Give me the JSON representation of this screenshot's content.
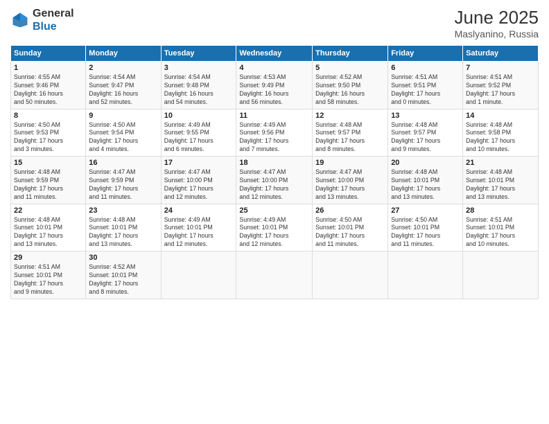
{
  "header": {
    "logo_general": "General",
    "logo_blue": "Blue",
    "title": "June 2025",
    "location": "Maslyanino, Russia"
  },
  "columns": [
    "Sunday",
    "Monday",
    "Tuesday",
    "Wednesday",
    "Thursday",
    "Friday",
    "Saturday"
  ],
  "weeks": [
    [
      {
        "day": "1",
        "info": "Sunrise: 4:55 AM\nSunset: 9:46 PM\nDaylight: 16 hours\nand 50 minutes."
      },
      {
        "day": "2",
        "info": "Sunrise: 4:54 AM\nSunset: 9:47 PM\nDaylight: 16 hours\nand 52 minutes."
      },
      {
        "day": "3",
        "info": "Sunrise: 4:54 AM\nSunset: 9:48 PM\nDaylight: 16 hours\nand 54 minutes."
      },
      {
        "day": "4",
        "info": "Sunrise: 4:53 AM\nSunset: 9:49 PM\nDaylight: 16 hours\nand 56 minutes."
      },
      {
        "day": "5",
        "info": "Sunrise: 4:52 AM\nSunset: 9:50 PM\nDaylight: 16 hours\nand 58 minutes."
      },
      {
        "day": "6",
        "info": "Sunrise: 4:51 AM\nSunset: 9:51 PM\nDaylight: 17 hours\nand 0 minutes."
      },
      {
        "day": "7",
        "info": "Sunrise: 4:51 AM\nSunset: 9:52 PM\nDaylight: 17 hours\nand 1 minute."
      }
    ],
    [
      {
        "day": "8",
        "info": "Sunrise: 4:50 AM\nSunset: 9:53 PM\nDaylight: 17 hours\nand 3 minutes."
      },
      {
        "day": "9",
        "info": "Sunrise: 4:50 AM\nSunset: 9:54 PM\nDaylight: 17 hours\nand 4 minutes."
      },
      {
        "day": "10",
        "info": "Sunrise: 4:49 AM\nSunset: 9:55 PM\nDaylight: 17 hours\nand 6 minutes."
      },
      {
        "day": "11",
        "info": "Sunrise: 4:49 AM\nSunset: 9:56 PM\nDaylight: 17 hours\nand 7 minutes."
      },
      {
        "day": "12",
        "info": "Sunrise: 4:48 AM\nSunset: 9:57 PM\nDaylight: 17 hours\nand 8 minutes."
      },
      {
        "day": "13",
        "info": "Sunrise: 4:48 AM\nSunset: 9:57 PM\nDaylight: 17 hours\nand 9 minutes."
      },
      {
        "day": "14",
        "info": "Sunrise: 4:48 AM\nSunset: 9:58 PM\nDaylight: 17 hours\nand 10 minutes."
      }
    ],
    [
      {
        "day": "15",
        "info": "Sunrise: 4:48 AM\nSunset: 9:59 PM\nDaylight: 17 hours\nand 11 minutes."
      },
      {
        "day": "16",
        "info": "Sunrise: 4:47 AM\nSunset: 9:59 PM\nDaylight: 17 hours\nand 11 minutes."
      },
      {
        "day": "17",
        "info": "Sunrise: 4:47 AM\nSunset: 10:00 PM\nDaylight: 17 hours\nand 12 minutes."
      },
      {
        "day": "18",
        "info": "Sunrise: 4:47 AM\nSunset: 10:00 PM\nDaylight: 17 hours\nand 12 minutes."
      },
      {
        "day": "19",
        "info": "Sunrise: 4:47 AM\nSunset: 10:00 PM\nDaylight: 17 hours\nand 13 minutes."
      },
      {
        "day": "20",
        "info": "Sunrise: 4:48 AM\nSunset: 10:01 PM\nDaylight: 17 hours\nand 13 minutes."
      },
      {
        "day": "21",
        "info": "Sunrise: 4:48 AM\nSunset: 10:01 PM\nDaylight: 17 hours\nand 13 minutes."
      }
    ],
    [
      {
        "day": "22",
        "info": "Sunrise: 4:48 AM\nSunset: 10:01 PM\nDaylight: 17 hours\nand 13 minutes."
      },
      {
        "day": "23",
        "info": "Sunrise: 4:48 AM\nSunset: 10:01 PM\nDaylight: 17 hours\nand 13 minutes."
      },
      {
        "day": "24",
        "info": "Sunrise: 4:49 AM\nSunset: 10:01 PM\nDaylight: 17 hours\nand 12 minutes."
      },
      {
        "day": "25",
        "info": "Sunrise: 4:49 AM\nSunset: 10:01 PM\nDaylight: 17 hours\nand 12 minutes."
      },
      {
        "day": "26",
        "info": "Sunrise: 4:50 AM\nSunset: 10:01 PM\nDaylight: 17 hours\nand 11 minutes."
      },
      {
        "day": "27",
        "info": "Sunrise: 4:50 AM\nSunset: 10:01 PM\nDaylight: 17 hours\nand 11 minutes."
      },
      {
        "day": "28",
        "info": "Sunrise: 4:51 AM\nSunset: 10:01 PM\nDaylight: 17 hours\nand 10 minutes."
      }
    ],
    [
      {
        "day": "29",
        "info": "Sunrise: 4:51 AM\nSunset: 10:01 PM\nDaylight: 17 hours\nand 9 minutes."
      },
      {
        "day": "30",
        "info": "Sunrise: 4:52 AM\nSunset: 10:01 PM\nDaylight: 17 hours\nand 8 minutes."
      },
      {
        "day": "",
        "info": ""
      },
      {
        "day": "",
        "info": ""
      },
      {
        "day": "",
        "info": ""
      },
      {
        "day": "",
        "info": ""
      },
      {
        "day": "",
        "info": ""
      }
    ]
  ]
}
